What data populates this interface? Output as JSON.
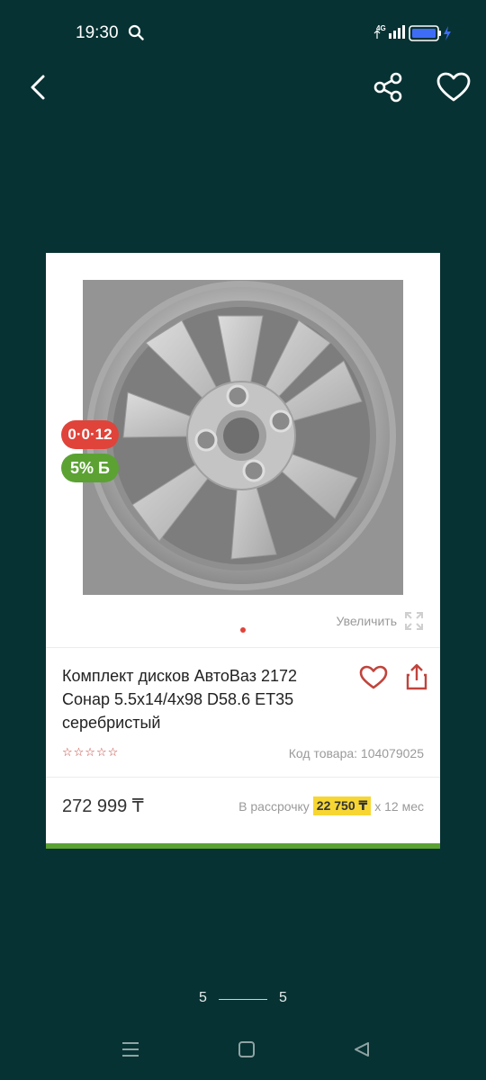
{
  "status_bar": {
    "time": "19:30",
    "network": "4G",
    "icons": [
      "search-icon",
      "signal-icon",
      "battery-icon",
      "charging-icon"
    ]
  },
  "toolbar": {
    "icons": [
      "back-arrow-icon",
      "share-icon",
      "heart-icon"
    ]
  },
  "product": {
    "badges": {
      "installment": "0·0·12",
      "bonus": "5% Б"
    },
    "zoom_label": "Увеличить",
    "title": "Комплект дисков АвтоВаз 2172 Сонар 5.5x14/4x98 D58.6 ET35 серебристый",
    "rating_stars": "☆☆☆☆☆",
    "code_label": "Код товара: 104079025",
    "price": "272 999 ₸",
    "installment_prefix": "В рассрочку",
    "installment_monthly": "22 750 ₸",
    "installment_suffix": "x 12 мес",
    "carousel_count": 1,
    "rating_value": 0
  },
  "pager": {
    "current": "5",
    "total": "5"
  },
  "colors": {
    "background": "#073233",
    "accent_red": "#e0433a",
    "accent_green": "#5ba233",
    "highlight_yellow": "#f7d633"
  },
  "navbar": {
    "icons": [
      "menu-icon",
      "home-icon",
      "back-icon"
    ]
  }
}
